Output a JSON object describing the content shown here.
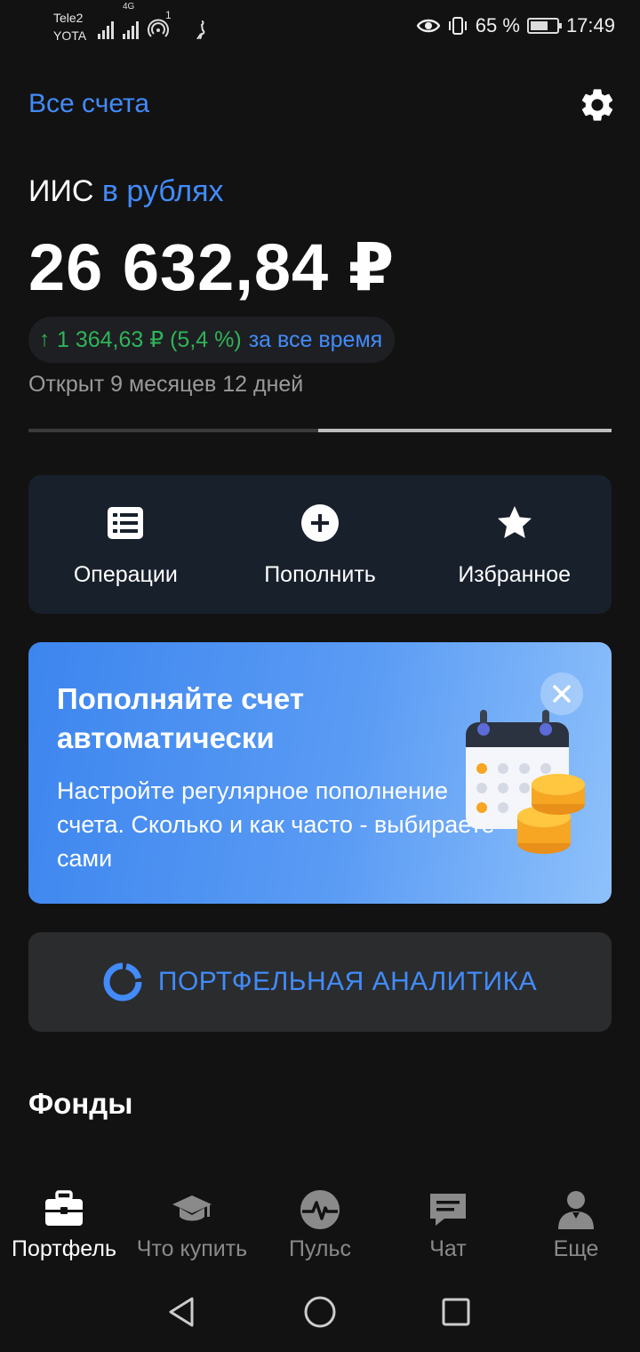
{
  "status_bar": {
    "carrier_1": "Tele2",
    "carrier_2": "YOTA",
    "network_badge": "4G",
    "sim_index": "1",
    "battery": "65 %",
    "time": "17:49"
  },
  "header": {
    "all_accounts": "Все счета",
    "settings_icon": "gear-icon"
  },
  "account": {
    "name": "ИИС",
    "currency": "в рублях",
    "balance": "26 632,84 ₽",
    "profit_arrow": "↑",
    "profit": "1 364,63 ₽ (5,4 %)",
    "profit_period": "за все время",
    "opened": "Открыт 9 месяцев 12 дней"
  },
  "actions": [
    {
      "label": "Операции",
      "icon": "list-icon"
    },
    {
      "label": "Пополнить",
      "icon": "plus-circle-icon"
    },
    {
      "label": "Избранное",
      "icon": "star-icon"
    }
  ],
  "promo": {
    "title": "Пополняйте счет автоматически",
    "text": "Настройте регулярное пополнение счета. Сколько и как часто - выбираете сами"
  },
  "analytics": {
    "label": "ПОРТФЕЛЬНАЯ АНАЛИТИКА"
  },
  "section": {
    "funds": "Фонды"
  },
  "bottom_nav": [
    {
      "label": "Портфель",
      "icon": "briefcase-icon",
      "active": true
    },
    {
      "label": "Что купить",
      "icon": "graduation-cap-icon",
      "active": false
    },
    {
      "label": "Пульс",
      "icon": "pulse-icon",
      "active": false
    },
    {
      "label": "Чат",
      "icon": "chat-icon",
      "active": false
    },
    {
      "label": "Еще",
      "icon": "person-icon",
      "active": false
    }
  ],
  "colors": {
    "background": "#121212",
    "accent_blue": "#428bf9",
    "profit_green": "#2fb45a",
    "card_dark": "#18202c"
  }
}
